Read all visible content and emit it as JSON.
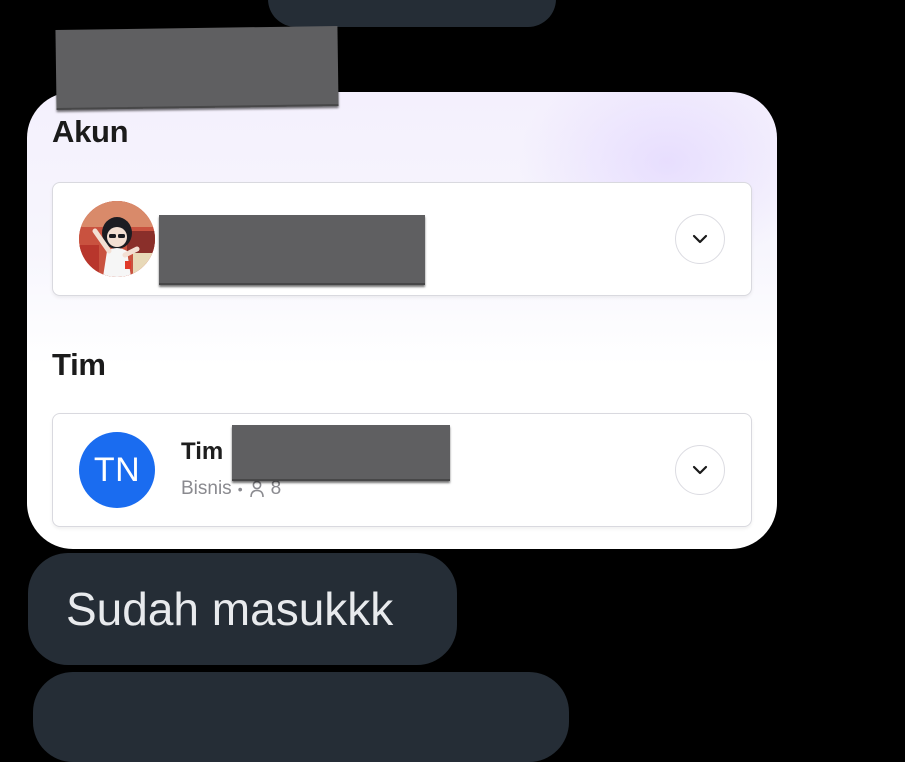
{
  "account": {
    "section_title": "Akun"
  },
  "team": {
    "section_title": "Tim",
    "name": "Tim",
    "avatar_initials": "TN",
    "plan": "Bisnis",
    "member_count": "8"
  },
  "messages": {
    "reply_text": "Sudah masukkk"
  },
  "colors": {
    "team_avatar": "#1a6cf0",
    "bubble": "#252d36",
    "background": "#000000"
  },
  "icons": {
    "dropdown": "chevron-down-icon",
    "members": "person-icon"
  }
}
